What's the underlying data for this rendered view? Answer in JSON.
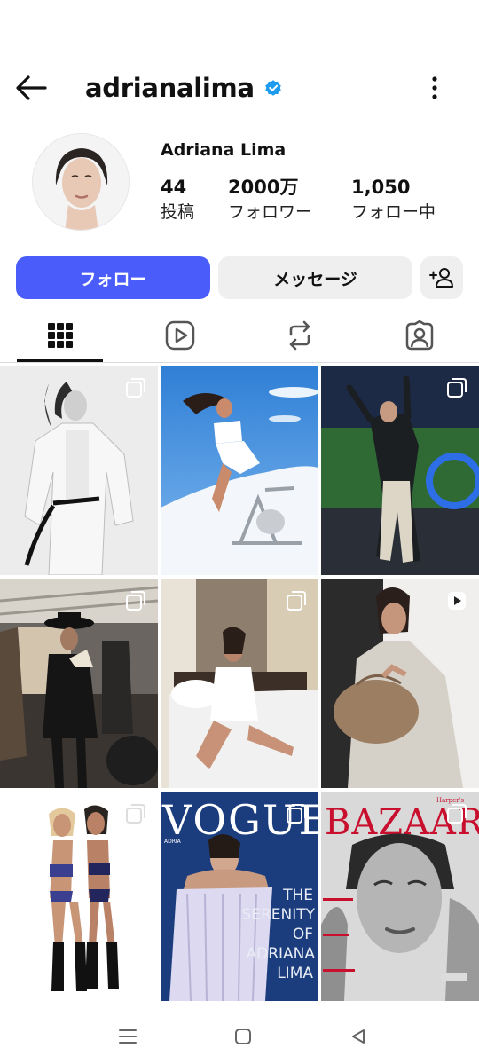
{
  "header": {
    "username": "adrianalima",
    "back_icon": "arrow-left-icon",
    "verified_icon": "verified-badge-icon",
    "menu_icon": "more-vertical-icon",
    "verified_color": "#1d9bf0"
  },
  "profile": {
    "display_name": "Adriana Lima",
    "stats": [
      {
        "value": "44",
        "label": "投稿"
      },
      {
        "value": "2000万",
        "label": "フォロワー"
      },
      {
        "value": "1,050",
        "label": "フォロー中"
      }
    ]
  },
  "actions": {
    "follow_label": "フォロー",
    "message_label": "メッセージ",
    "add_user_icon": "person-add-icon",
    "follow_color": "#4a5dfa"
  },
  "tabs": [
    {
      "icon": "grid-icon",
      "active": true
    },
    {
      "icon": "reels-icon",
      "active": false
    },
    {
      "icon": "reposts-icon",
      "active": false
    },
    {
      "icon": "tagged-icon",
      "active": false
    }
  ],
  "posts": [
    {
      "badge": "carousel-icon"
    },
    {
      "badge": "none"
    },
    {
      "badge": "carousel-icon"
    },
    {
      "badge": "carousel-icon"
    },
    {
      "badge": "carousel-icon"
    },
    {
      "badge": "reel-icon"
    },
    {
      "badge": "carousel-icon"
    },
    {
      "badge": "carousel-icon",
      "cover_text": [
        "VOGUE",
        "ADRIA",
        "THE",
        "SERENITY",
        "OF",
        "ADRIANA",
        "LIMA"
      ]
    },
    {
      "badge": "carousel-icon",
      "cover_text": [
        "BAZAAR",
        "Harper's"
      ]
    }
  ],
  "system_nav": {
    "recent_icon": "recent-apps-icon",
    "home_icon": "home-square-icon",
    "back_icon": "back-triangle-icon"
  }
}
